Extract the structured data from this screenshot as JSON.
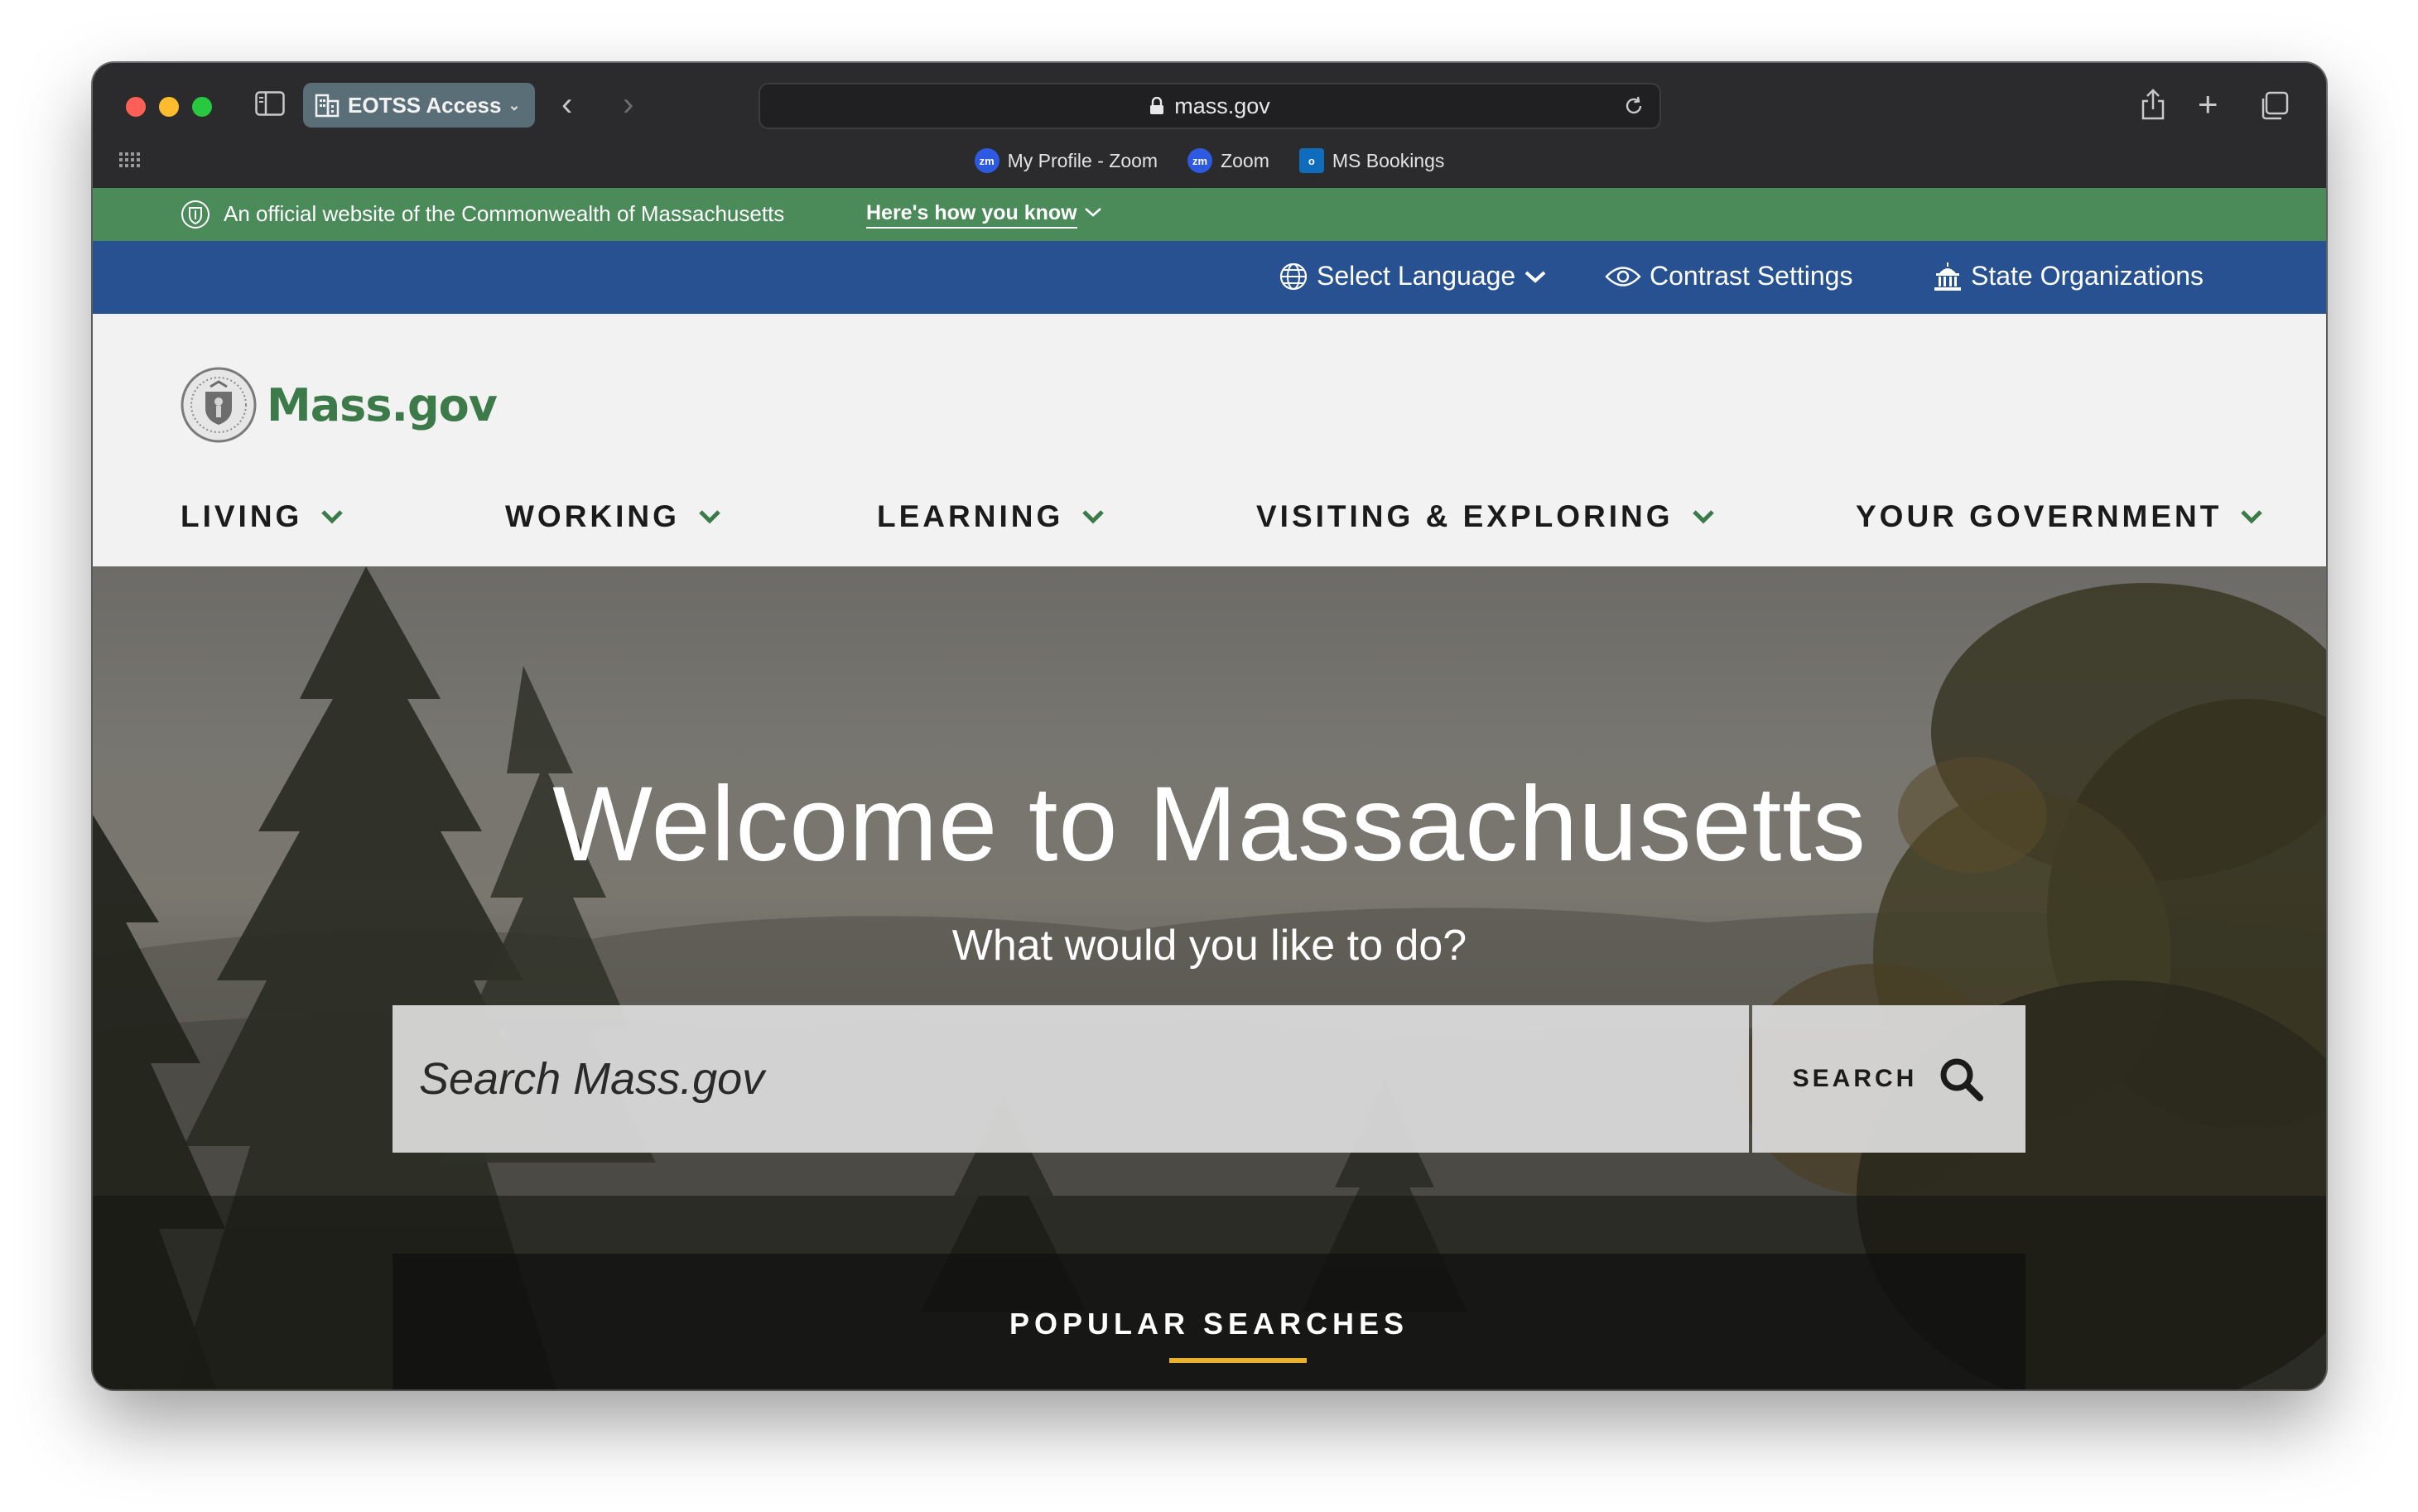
{
  "browser": {
    "tab_group": "EOTSS Access",
    "address": "mass.gov",
    "bookmarks": [
      {
        "label": "My Profile - Zoom",
        "icon": "zoom-icon"
      },
      {
        "label": "Zoom",
        "icon": "zoom-icon"
      },
      {
        "label": "MS Bookings",
        "icon": "outlook-icon"
      }
    ]
  },
  "banner": {
    "official_text": "An official website of the Commonwealth of Massachusetts",
    "how_you_know": "Here's how you know"
  },
  "utility_nav": {
    "language": "Select Language",
    "contrast": "Contrast Settings",
    "orgs": "State Organizations"
  },
  "header": {
    "logo_text": "Mass.gov",
    "nav": [
      {
        "label": "LIVING"
      },
      {
        "label": "WORKING"
      },
      {
        "label": "LEARNING"
      },
      {
        "label": "VISITING & EXPLORING"
      },
      {
        "label": "YOUR GOVERNMENT"
      }
    ]
  },
  "hero": {
    "title": "Welcome to Massachusetts",
    "subtitle": "What would you like to do?",
    "search_placeholder": "Search Mass.gov",
    "search_button": "SEARCH",
    "popular_label": "POPULAR SEARCHES"
  },
  "colors": {
    "official_banner": "#4b8b5a",
    "utility_bar": "#275191",
    "logo_green": "#3c7a4a",
    "popular_underline": "#eab12c"
  }
}
